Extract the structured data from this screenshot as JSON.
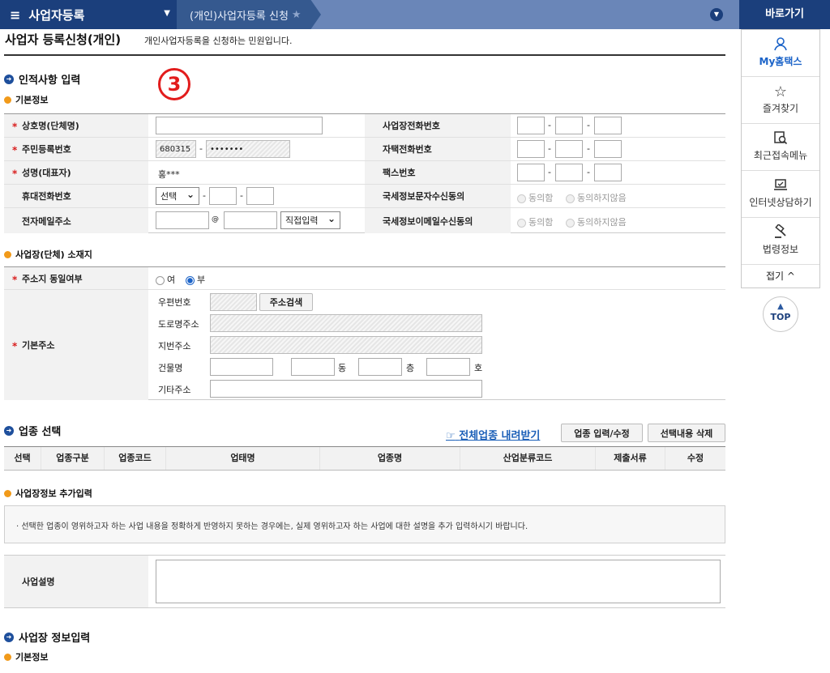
{
  "nav": {
    "menu_label": "사업자등록",
    "breadcrumb": "(개인)사업자등록 신청",
    "quick_title": "바로가기"
  },
  "quick_menu": [
    {
      "label": "My홈택스"
    },
    {
      "label": "즐겨찾기"
    },
    {
      "label": "최근접속메뉴"
    },
    {
      "label": "인터넷상담하기"
    },
    {
      "label": "법령정보"
    }
  ],
  "quick_fold": "접기 ^",
  "top_button": "TOP",
  "page": {
    "title": "사업자 등록신청(개인)",
    "subtitle": "개인사업자등록을 신청하는 민원입니다.",
    "step": "3"
  },
  "personal": {
    "section": "인적사항 입력",
    "sub": "기본정보",
    "name_label": "상호명(단체명)",
    "rrn_label": "주민등록번호",
    "rrn_front": "680315",
    "rrn_back": "•••••••",
    "rep_label": "성명(대표자)",
    "rep_value": "홍***",
    "mobile_label": "휴대전화번호",
    "mobile_select": "선택",
    "email_label": "전자메일주소",
    "email_at": "@",
    "email_select": "직접입력",
    "biz_phone_label": "사업장전화번호",
    "home_phone_label": "자택전화번호",
    "fax_label": "팩스번호",
    "sms_label": "국세정보문자수신동의",
    "email_consent_label": "국세정보이메일수신동의",
    "agree": "동의함",
    "disagree": "동의하지않음"
  },
  "location": {
    "sub": "사업장(단체) 소재지",
    "same_label": "주소지 동일여부",
    "yes": "여",
    "no": "부",
    "addr_label": "기본주소",
    "zip_label": "우편번호",
    "search_btn": "주소검색",
    "road_label": "도로명주소",
    "lot_label": "지번주소",
    "bldg_label": "건물명",
    "dong": "동",
    "floor": "층",
    "ho": "호",
    "etc_label": "기타주소"
  },
  "industry": {
    "section": "업종 선택",
    "download": "전체업종 내려받기",
    "edit_btn": "업종 입력/수정",
    "delete_btn": "선택내용 삭제",
    "columns": [
      "선택",
      "업종구분",
      "업종코드",
      "업태명",
      "업종명",
      "산업분류코드",
      "제출서류",
      "수정"
    ]
  },
  "extra": {
    "sub": "사업장정보 추가입력",
    "notice": "· 선택한 업종이 영위하고자 하는 사업 내용을 정확하게 반영하지 못하는 경우에는, 실제 영위하고자 하는 사업에 대한 설명을 추가 입력하시기 바랍니다.",
    "desc_label": "사업설명"
  },
  "business": {
    "section": "사업장 정보입력",
    "sub": "기본정보"
  }
}
